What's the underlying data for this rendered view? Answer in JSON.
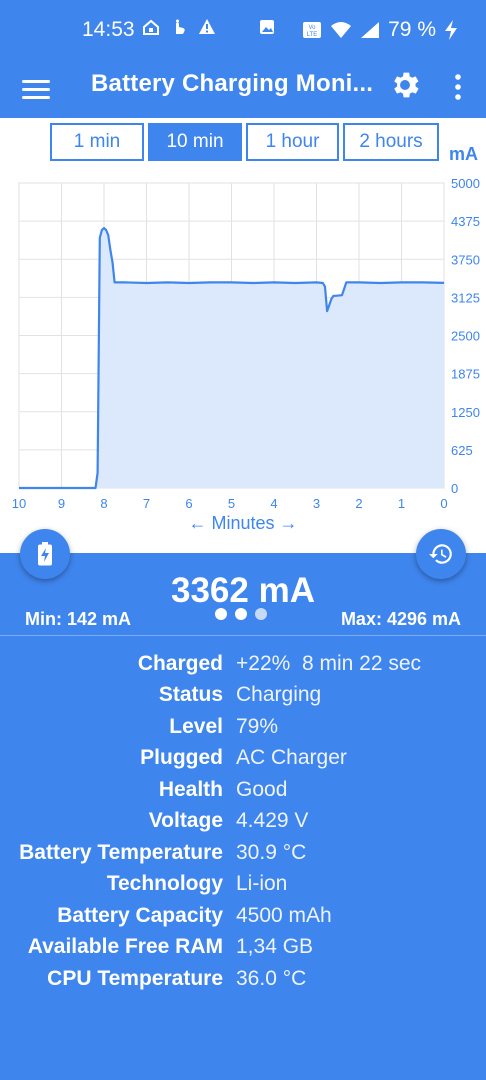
{
  "status_bar": {
    "time": "14:53",
    "battery": "79 %"
  },
  "app_bar": {
    "title": "Battery Charging Moni..."
  },
  "tabs": [
    {
      "label": "1 min",
      "active": false
    },
    {
      "label": "10 min",
      "active": true
    },
    {
      "label": "1 hour",
      "active": false
    },
    {
      "label": "2 hours",
      "active": false
    }
  ],
  "unit": "mA",
  "chart_data": {
    "type": "area",
    "ylabel": "mA",
    "xlabel": "← Minutes →",
    "xlim": [
      10,
      0
    ],
    "ylim": [
      0,
      5000
    ],
    "y_ticks": [
      "0",
      "625",
      "1250",
      "1875",
      "2500",
      "3125",
      "3750",
      "4375",
      "5000"
    ],
    "x_ticks": [
      "10",
      "9",
      "8",
      "7",
      "6",
      "5",
      "4",
      "3",
      "2",
      "1",
      "0"
    ],
    "grid": true,
    "series": [
      {
        "x": [
          10,
          8.2,
          8.15,
          8.1,
          8.05,
          8.0,
          7.95,
          7.9,
          7.85,
          7.8,
          7.75,
          7.7,
          7.5,
          7.0,
          6.5,
          6.0,
          5.5,
          5.0,
          4.5,
          4.0,
          3.5,
          3.0,
          2.85,
          2.8,
          2.75,
          2.7,
          2.65,
          2.6,
          2.55,
          2.4,
          2.3,
          2.0,
          1.5,
          1.0,
          0.5,
          0
        ],
        "y": [
          0,
          0,
          250,
          4100,
          4230,
          4260,
          4230,
          4150,
          3900,
          3700,
          3370,
          3370,
          3370,
          3360,
          3370,
          3360,
          3370,
          3370,
          3360,
          3370,
          3360,
          3370,
          3360,
          3300,
          2900,
          3000,
          3100,
          3150,
          3150,
          3160,
          3370,
          3370,
          3360,
          3370,
          3370,
          3362
        ]
      }
    ]
  },
  "current": "3362 mA",
  "min": "Min: 142 mA",
  "max": "Max: 4296 mA",
  "info": [
    {
      "label": "Charged",
      "value": "+22%  8 min 22 sec"
    },
    {
      "label": "Status",
      "value": "Charging"
    },
    {
      "label": "Level",
      "value": "79%"
    },
    {
      "label": "Plugged",
      "value": "AC Charger"
    },
    {
      "label": "Health",
      "value": "Good"
    },
    {
      "label": "Voltage",
      "value": "4.429 V"
    },
    {
      "label": "Battery Temperature",
      "value": "30.9 °C"
    },
    {
      "label": "Technology",
      "value": "Li-ion"
    },
    {
      "label": "Battery Capacity",
      "value": "4500 mAh"
    },
    {
      "label": "Available Free RAM",
      "value": "1,34 GB"
    },
    {
      "label": "CPU Temperature",
      "value": "36.0 °C"
    }
  ],
  "colors": {
    "accent": "#3f85ee",
    "chart_fill": "#dce8fc",
    "grid": "#e2e2e2"
  }
}
